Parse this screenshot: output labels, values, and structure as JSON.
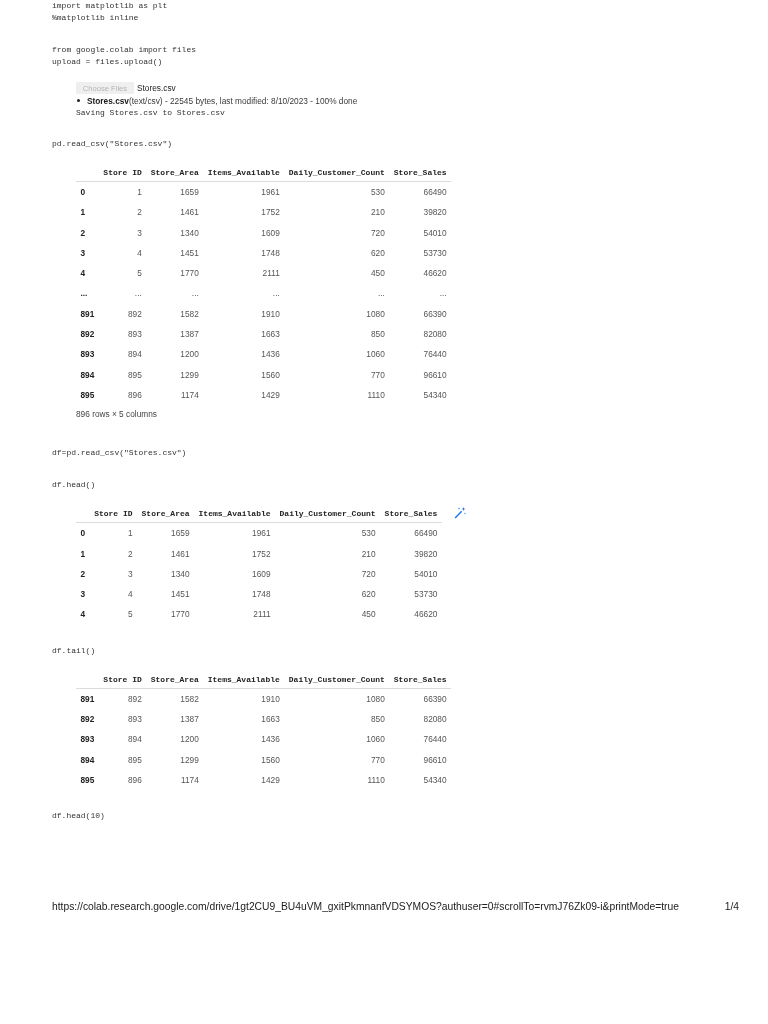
{
  "cells": [
    {
      "kind": "code",
      "code": [
        "import matplotlib as plt",
        "%matplotlib inline"
      ]
    },
    {
      "kind": "code",
      "code": [
        "from google.colab import files",
        "upload = files.upload()"
      ],
      "output": {
        "kind": "upload",
        "button": {
          "label": "Choose Files",
          "disabled": true
        },
        "file_label": "Stores.csv",
        "files": [
          {
            "status": "**Stores.csv**(text/csv) - 22545 bytes, last modified: 8/10/2023 - 100% done"
          }
        ],
        "stream": [
          "Saving Stores.csv to Stores.csv"
        ]
      }
    },
    {
      "kind": "code",
      "code": [
        "pd.read_csv(\"Stores.csv\")"
      ],
      "output": {
        "kind": "dataframe",
        "columns": [
          "Store ID",
          "Store_Area",
          "Items_Available",
          "Daily_Customer_Count",
          "Store_Sales"
        ],
        "rows": [
          {
            "index": "0",
            "cells": [
              "1",
              "1659",
              "1961",
              "530",
              "66490"
            ]
          },
          {
            "index": "1",
            "cells": [
              "2",
              "1461",
              "1752",
              "210",
              "39820"
            ]
          },
          {
            "index": "2",
            "cells": [
              "3",
              "1340",
              "1609",
              "720",
              "54010"
            ]
          },
          {
            "index": "3",
            "cells": [
              "4",
              "1451",
              "1748",
              "620",
              "53730"
            ]
          },
          {
            "index": "4",
            "cells": [
              "5",
              "1770",
              "2111",
              "450",
              "46620"
            ]
          },
          {
            "index": "...",
            "cells": [
              "...",
              "...",
              "...",
              "...",
              "..."
            ]
          },
          {
            "index": "891",
            "cells": [
              "892",
              "1582",
              "1910",
              "1080",
              "66390"
            ]
          },
          {
            "index": "892",
            "cells": [
              "893",
              "1387",
              "1663",
              "850",
              "82080"
            ]
          },
          {
            "index": "893",
            "cells": [
              "894",
              "1200",
              "1436",
              "1060",
              "76440"
            ]
          },
          {
            "index": "894",
            "cells": [
              "895",
              "1299",
              "1560",
              "770",
              "96610"
            ]
          },
          {
            "index": "895",
            "cells": [
              "896",
              "1174",
              "1429",
              "1110",
              "54340"
            ]
          }
        ],
        "caption": "896 rows × 5 columns"
      }
    },
    {
      "kind": "code",
      "code": [
        "df=pd.read_csv(\"Stores.csv\")"
      ]
    },
    {
      "kind": "code",
      "code": [
        "df.head()"
      ],
      "output": {
        "kind": "dataframe",
        "chart_suggestions": true,
        "columns": [
          "Store ID",
          "Store_Area",
          "Items_Available",
          "Daily_Customer_Count",
          "Store_Sales"
        ],
        "rows": [
          {
            "index": "0",
            "cells": [
              "1",
              "1659",
              "1961",
              "530",
              "66490"
            ]
          },
          {
            "index": "1",
            "cells": [
              "2",
              "1461",
              "1752",
              "210",
              "39820"
            ]
          },
          {
            "index": "2",
            "cells": [
              "3",
              "1340",
              "1609",
              "720",
              "54010"
            ]
          },
          {
            "index": "3",
            "cells": [
              "4",
              "1451",
              "1748",
              "620",
              "53730"
            ]
          },
          {
            "index": "4",
            "cells": [
              "5",
              "1770",
              "2111",
              "450",
              "46620"
            ]
          }
        ]
      }
    },
    {
      "kind": "code",
      "code": [
        "df.tail()"
      ],
      "output": {
        "kind": "dataframe",
        "columns": [
          "Store ID",
          "Store_Area",
          "Items_Available",
          "Daily_Customer_Count",
          "Store_Sales"
        ],
        "rows": [
          {
            "index": "891",
            "cells": [
              "892",
              "1582",
              "1910",
              "1080",
              "66390"
            ]
          },
          {
            "index": "892",
            "cells": [
              "893",
              "1387",
              "1663",
              "850",
              "82080"
            ]
          },
          {
            "index": "893",
            "cells": [
              "894",
              "1200",
              "1436",
              "1060",
              "76440"
            ]
          },
          {
            "index": "894",
            "cells": [
              "895",
              "1299",
              "1560",
              "770",
              "96610"
            ]
          },
          {
            "index": "895",
            "cells": [
              "896",
              "1174",
              "1429",
              "1110",
              "54340"
            ]
          }
        ]
      }
    },
    {
      "kind": "code",
      "code": [
        "df.head(10)"
      ]
    }
  ],
  "footer": {
    "url": "https://colab.research.google.com/drive/1gt2CU9_BU4uVM_gxitPkmnanfVDSYMOS?authuser=0#scrollTo=rvmJ76Zk09-i&printMode=true",
    "page": "1/4"
  }
}
